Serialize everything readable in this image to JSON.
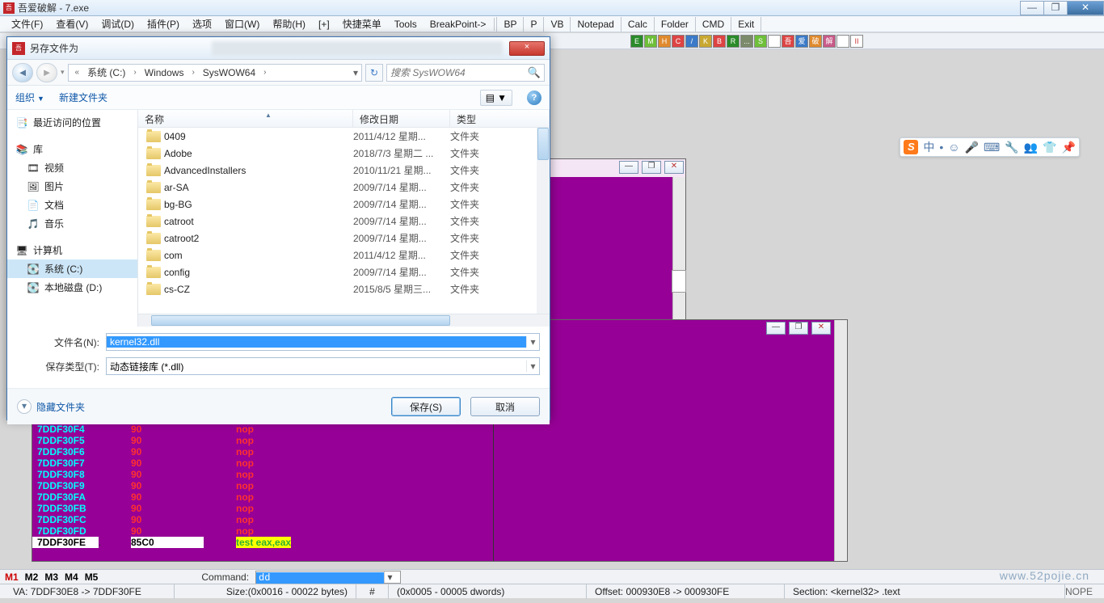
{
  "main_window": {
    "title": "吾爱破解 - 7.exe",
    "win_controls": {
      "min": "—",
      "max": "❐",
      "close": "✕"
    }
  },
  "menu": [
    "文件(F)",
    "查看(V)",
    "调试(D)",
    "插件(P)",
    "选项",
    "窗口(W)",
    "帮助(H)",
    "[+]",
    "快捷菜单",
    "Tools",
    "BreakPoint->"
  ],
  "menu_right": [
    "BP",
    "P",
    "VB",
    "Notepad",
    "Calc",
    "Folder",
    "CMD",
    "Exit"
  ],
  "toolbar_icons": [
    "E",
    "M",
    "H",
    "C",
    "/",
    "K",
    "B",
    "R",
    "...",
    "S",
    "",
    "吾",
    "爱",
    "破",
    "解",
    "",
    "II"
  ],
  "topright_panel": {
    "min": "—",
    "max": "❐",
    "close": "✕"
  },
  "disasm_panel": {
    "min": "—",
    "max": "❐",
    "close": "✕"
  },
  "disasm": {
    "rows": [
      {
        "addr": "7DDF30F4",
        "hex": "90",
        "mnem": "nop"
      },
      {
        "addr": "7DDF30F5",
        "hex": "90",
        "mnem": "nop"
      },
      {
        "addr": "7DDF30F6",
        "hex": "90",
        "mnem": "nop"
      },
      {
        "addr": "7DDF30F7",
        "hex": "90",
        "mnem": "nop"
      },
      {
        "addr": "7DDF30F8",
        "hex": "90",
        "mnem": "nop"
      },
      {
        "addr": "7DDF30F9",
        "hex": "90",
        "mnem": "nop"
      },
      {
        "addr": "7DDF30FA",
        "hex": "90",
        "mnem": "nop"
      },
      {
        "addr": "7DDF30FB",
        "hex": "90",
        "mnem": "nop"
      },
      {
        "addr": "7DDF30FC",
        "hex": "90",
        "mnem": "nop"
      },
      {
        "addr": "7DDF30FD",
        "hex": "90",
        "mnem": "nop"
      },
      {
        "addr": "7DDF30FE",
        "hex": "85C0",
        "mnem": "test eax,eax",
        "test": true
      }
    ]
  },
  "saveas": {
    "title": "另存文件为",
    "close": "×",
    "nav_back": "◄",
    "nav_fwd": "►",
    "nav_drop": "▾",
    "refresh": "↻",
    "breadcrumb": [
      "«",
      "系统 (C:)",
      "›",
      "Windows",
      "›",
      "SysWOW64",
      "›"
    ],
    "search_placeholder": "搜索 SysWOW64",
    "organize": "组织",
    "organize_dd": "▼",
    "newfolder": "新建文件夹",
    "view_dd": "▼",
    "help": "?",
    "tree": [
      {
        "label": "最近访问的位置",
        "icon": "📑",
        "class": "group"
      },
      {
        "label": "库",
        "icon": "📚",
        "class": "lib group"
      },
      {
        "label": "视频",
        "icon": "🎞",
        "class": ""
      },
      {
        "label": "图片",
        "icon": "🖼",
        "class": ""
      },
      {
        "label": "文档",
        "icon": "📄",
        "class": ""
      },
      {
        "label": "音乐",
        "icon": "🎵",
        "class": ""
      },
      {
        "label": "计算机",
        "icon": "🖥",
        "class": "group"
      },
      {
        "label": "系统 (C:)",
        "icon": "💽",
        "class": "sel"
      },
      {
        "label": "本地磁盘 (D:)",
        "icon": "💽",
        "class": ""
      }
    ],
    "columns": {
      "name": "名称",
      "date": "修改日期",
      "type": "类型"
    },
    "files": [
      {
        "name": "0409",
        "date": "2011/4/12 星期...",
        "type": "文件夹"
      },
      {
        "name": "Adobe",
        "date": "2018/7/3 星期二 ...",
        "type": "文件夹"
      },
      {
        "name": "AdvancedInstallers",
        "date": "2010/11/21 星期...",
        "type": "文件夹"
      },
      {
        "name": "ar-SA",
        "date": "2009/7/14 星期...",
        "type": "文件夹"
      },
      {
        "name": "bg-BG",
        "date": "2009/7/14 星期...",
        "type": "文件夹"
      },
      {
        "name": "catroot",
        "date": "2009/7/14 星期...",
        "type": "文件夹"
      },
      {
        "name": "catroot2",
        "date": "2009/7/14 星期...",
        "type": "文件夹"
      },
      {
        "name": "com",
        "date": "2011/4/12 星期...",
        "type": "文件夹"
      },
      {
        "name": "config",
        "date": "2009/7/14 星期...",
        "type": "文件夹"
      },
      {
        "name": "cs-CZ",
        "date": "2015/8/5 星期三...",
        "type": "文件夹"
      }
    ],
    "filename_label": "文件名(N):",
    "filename_value": "kernel32.dll",
    "savetype_label": "保存类型(T):",
    "savetype_value": "动态链接库 (*.dll)",
    "hide_folders": "隐藏文件夹",
    "expand": "▾",
    "save_btn": "保存(S)",
    "cancel_btn": "取消"
  },
  "status1": {
    "marks": [
      "M1",
      "M2",
      "M3",
      "M4",
      "M5"
    ],
    "command_label": "Command:",
    "command_value": "dd"
  },
  "status2": {
    "va": "VA: 7DDF30E8 -> 7DDF30FE",
    "size": "Size:(0x0016 - 00022 bytes)",
    "hash": "#",
    "dwords": "(0x0005 - 00005 dwords)",
    "offset": "Offset: 000930E8 -> 000930FE",
    "section": "Section: <kernel32> .text",
    "nope": "NOPE"
  },
  "ime": {
    "s": "S",
    "zhong": "中",
    "icons": [
      "•",
      "☺",
      "🎤",
      "⌨",
      "🔧",
      "👥",
      "👕",
      "📌"
    ]
  },
  "watermark": "www.52pojie.cn"
}
